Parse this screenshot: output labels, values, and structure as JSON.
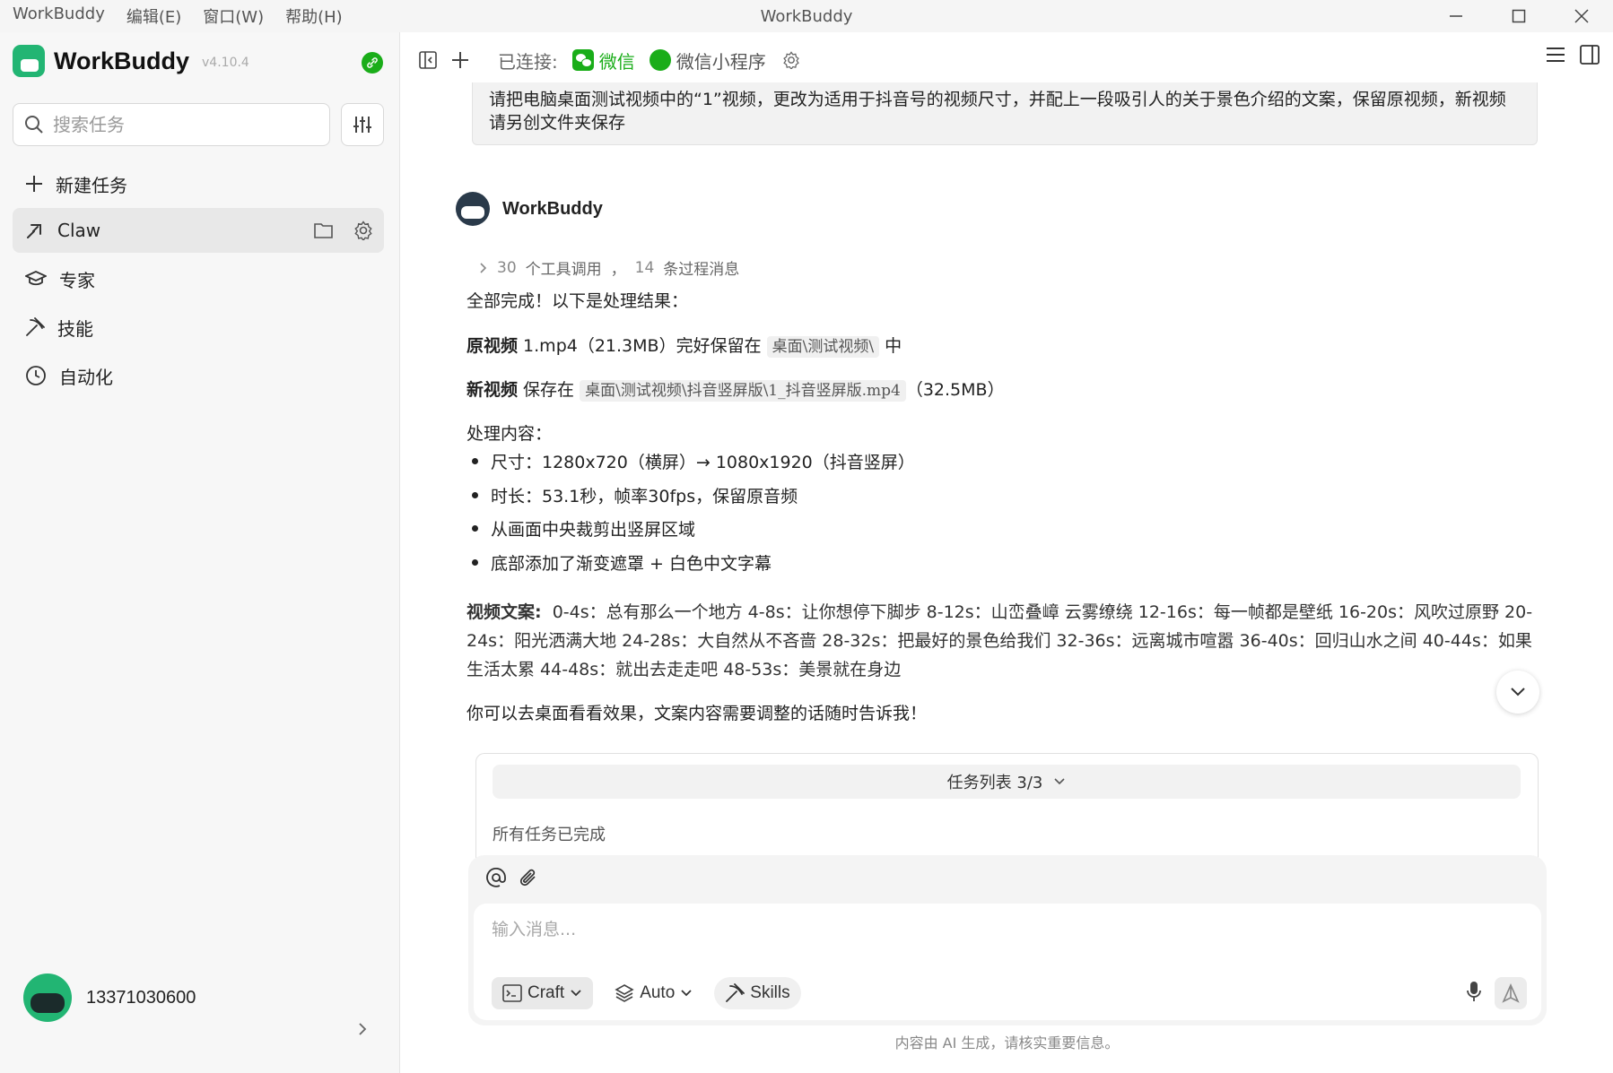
{
  "titlebar": {
    "app": "WorkBuddy",
    "menu": [
      "编辑(E)",
      "窗口(W)",
      "帮助(H)"
    ],
    "window_title": "WorkBuddy"
  },
  "sidebar": {
    "brand": "WorkBuddy",
    "version": "v4.10.4",
    "search_placeholder": "搜索任务",
    "new_task": "新建任务",
    "items": [
      {
        "label": "Claw",
        "icon": "claw-icon",
        "active": true
      },
      {
        "label": "专家",
        "icon": "graduation-cap-icon"
      },
      {
        "label": "技能",
        "icon": "pickaxe-icon"
      },
      {
        "label": "自动化",
        "icon": "clock-icon"
      }
    ],
    "user_phone": "13371030600"
  },
  "toolbar": {
    "connected_label": "已连接:",
    "wechat": "微信",
    "mini_program": "微信小程序"
  },
  "chat": {
    "user_message": "请把电脑桌面测试视频中的“1”视频，更改为适用于抖音号的视频尺寸，并配上一段吸引人的关于景色介绍的文案，保留原视频，新视频请另创文件夹保存",
    "bot_name": "WorkBuddy",
    "tool_calls_count": "30",
    "tool_calls_label": "个工具调用",
    "sep": "，",
    "process_count": "14",
    "process_label": "条过程消息",
    "done_line": "全部完成！以下是处理结果：",
    "orig_label": "原视频",
    "orig_text": " 1.mp4（21.3MB）完好保留在 ",
    "orig_path": "桌面\\测试视频\\",
    "orig_suffix": " 中",
    "new_label": "新视频",
    "new_text": " 保存在 ",
    "new_path": "桌面\\测试视频\\抖音竖屏版\\1_抖音竖屏版.mp4",
    "new_suffix": "（32.5MB）",
    "process_heading": "处理内容：",
    "bullets": [
      "尺寸：1280x720（横屏）→ 1080x1920（抖音竖屏）",
      "时长：53.1秒，帧率30fps，保留原音频",
      "从画面中央裁剪出竖屏区域",
      "底部添加了渐变遮罩 + 白色中文字幕"
    ],
    "copy_label": "视频文案:",
    "copy_text": "0-4s：总有那么一个地方 4-8s：让你想停下脚步 8-12s：山峦叠嶂 云雾缭绕 12-16s：每一帧都是壁纸 16-20s：风吹过原野 20-24s：阳光洒满大地 24-28s：大自然从不吝啬 28-32s：把最好的景色给我们 32-36s：远离城市喧嚣 36-40s：回归山水之间 40-44s：如果生活太累 44-48s：就出去走走吧 48-53s：美景就在身边",
    "closing": "你可以去桌面看看效果，文案内容需要调整的话随时告诉我！"
  },
  "task_card": {
    "title": "任务列表 3/3",
    "status": "所有任务已完成"
  },
  "composer": {
    "placeholder": "输入消息...",
    "craft": "Craft",
    "auto": "Auto",
    "skills": "Skills"
  },
  "disclaimer": "内容由 AI 生成，请核实重要信息。",
  "colors": {
    "accent": "#22b573",
    "wechat": "#1aad19"
  }
}
